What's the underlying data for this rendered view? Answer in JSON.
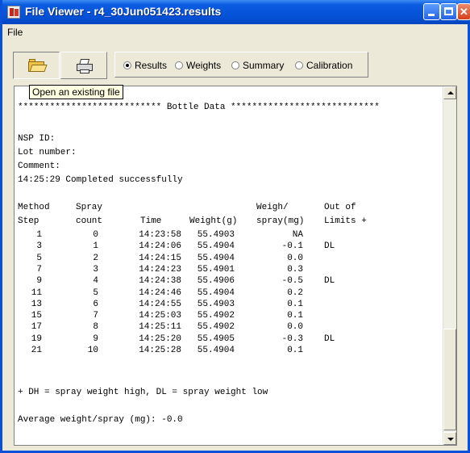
{
  "window": {
    "title": "File Viewer - r4_30Jun051423.results"
  },
  "menu": {
    "file": "File"
  },
  "toolbar": {
    "open_tooltip": "Open an existing file",
    "radios": [
      {
        "label": "Results",
        "checked": true
      },
      {
        "label": "Weights",
        "checked": false
      },
      {
        "label": "Summary",
        "checked": false
      },
      {
        "label": "Calibration",
        "checked": false
      }
    ]
  },
  "report": {
    "banner": "*************************** Bottle Data ****************************",
    "nsp_id": "NSP ID:",
    "lot_number": "Lot number:",
    "comment": "Comment:",
    "status": "14:25:29 Completed successfully",
    "headers": {
      "method": [
        "Method",
        "Step"
      ],
      "spray": [
        "Spray",
        "count"
      ],
      "time": [
        "",
        "Time"
      ],
      "weight": [
        "",
        "Weight(g)"
      ],
      "weigh_spray": [
        "Weigh/",
        "spray(mg)"
      ],
      "out_of_limits": [
        "Out of",
        "Limits +"
      ]
    },
    "rows": [
      {
        "step": "1",
        "count": "0",
        "time": "14:23:58",
        "weight": "55.4903",
        "spray": "NA",
        "limits": ""
      },
      {
        "step": "3",
        "count": "1",
        "time": "14:24:06",
        "weight": "55.4904",
        "spray": "-0.1",
        "limits": "DL"
      },
      {
        "step": "5",
        "count": "2",
        "time": "14:24:15",
        "weight": "55.4904",
        "spray": "0.0",
        "limits": ""
      },
      {
        "step": "7",
        "count": "3",
        "time": "14:24:23",
        "weight": "55.4901",
        "spray": "0.3",
        "limits": ""
      },
      {
        "step": "9",
        "count": "4",
        "time": "14:24:38",
        "weight": "55.4906",
        "spray": "-0.5",
        "limits": "DL"
      },
      {
        "step": "11",
        "count": "5",
        "time": "14:24:46",
        "weight": "55.4904",
        "spray": "0.2",
        "limits": ""
      },
      {
        "step": "13",
        "count": "6",
        "time": "14:24:55",
        "weight": "55.4903",
        "spray": "0.1",
        "limits": ""
      },
      {
        "step": "15",
        "count": "7",
        "time": "14:25:03",
        "weight": "55.4902",
        "spray": "0.1",
        "limits": ""
      },
      {
        "step": "17",
        "count": "8",
        "time": "14:25:11",
        "weight": "55.4902",
        "spray": "0.0",
        "limits": ""
      },
      {
        "step": "19",
        "count": "9",
        "time": "14:25:20",
        "weight": "55.4905",
        "spray": "-0.3",
        "limits": "DL"
      },
      {
        "step": "21",
        "count": "10",
        "time": "14:25:28",
        "weight": "55.4904",
        "spray": "0.1",
        "limits": ""
      }
    ],
    "legend": "+ DH = spray weight high, DL = spray weight low",
    "average": "Average weight/spray (mg): -0.0"
  },
  "icons": {
    "app": "app-icon",
    "open": "folder-open-icon",
    "print": "printer-icon",
    "minimize": "minimize-icon",
    "maximize": "maximize-icon",
    "close": "close-icon"
  },
  "colors": {
    "titlebar": "#0551d6",
    "tooltip_bg": "#ffffe1",
    "window_bg": "#ece9d8"
  }
}
